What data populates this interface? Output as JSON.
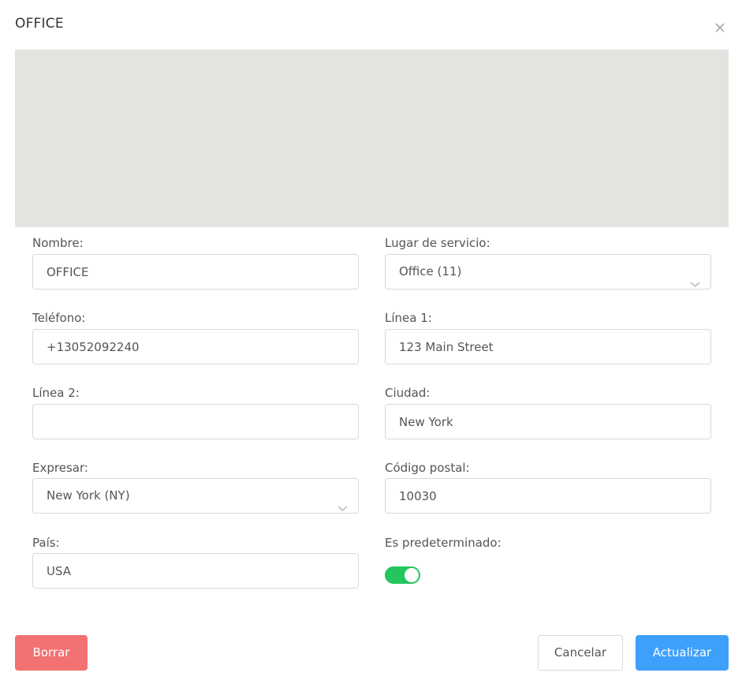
{
  "dialog": {
    "title": "OFFICE",
    "close_icon": "close-icon"
  },
  "form": {
    "nombre": {
      "label": "Nombre:",
      "value": "OFFICE"
    },
    "lugar": {
      "label": "Lugar de servicio:",
      "value": "Office (11)",
      "icon": "chevron-down-icon"
    },
    "telefono": {
      "label": "Teléfono:",
      "value": "+13052092240"
    },
    "linea1": {
      "label": "Línea 1:",
      "value": "123 Main Street"
    },
    "linea2": {
      "label": "Línea 2:",
      "value": ""
    },
    "ciudad": {
      "label": "Ciudad:",
      "value": "New York"
    },
    "expresar": {
      "label": "Expresar:",
      "value": "New York (NY)",
      "icon": "chevron-down-icon"
    },
    "codigo": {
      "label": "Código postal:",
      "value": "10030"
    },
    "pais": {
      "label": "País:",
      "value": "USA"
    },
    "predeterminado": {
      "label": "Es predeterminado:",
      "on": true,
      "color": "#22c55e"
    }
  },
  "buttons": {
    "delete": "Borrar",
    "cancel": "Cancelar",
    "update": "Actualizar"
  },
  "colors": {
    "delete": "#f27171",
    "update": "#3da0fa",
    "map_placeholder": "#e5e3df"
  }
}
